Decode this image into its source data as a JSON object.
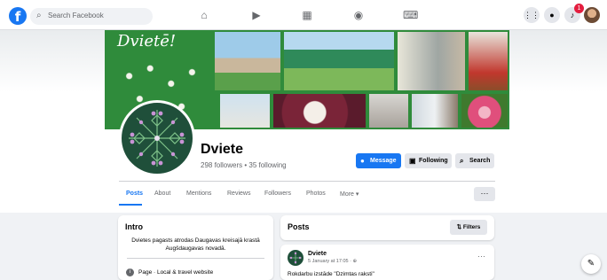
{
  "topbar": {
    "search_placeholder": "Search Facebook",
    "nav_icons": [
      "home-icon",
      "video-icon",
      "marketplace-icon",
      "groups-icon",
      "gaming-icon"
    ],
    "notification_count": "1"
  },
  "cover": {
    "title": "Dvietē!"
  },
  "page": {
    "name": "Dviete",
    "stats": "298 followers • 35 following"
  },
  "actions": {
    "message": "Message",
    "following": "Following",
    "search": "Search"
  },
  "tabs": [
    {
      "label": "Posts",
      "active": true
    },
    {
      "label": "About"
    },
    {
      "label": "Mentions"
    },
    {
      "label": "Reviews"
    },
    {
      "label": "Followers"
    },
    {
      "label": "Photos"
    },
    {
      "label": "More ▾"
    }
  ],
  "intro": {
    "title": "Intro",
    "bio": "Dvietes pagasts atrodas Daugavas kreisajā krastā Augšdaugavas novadā.",
    "info": "Page · Local & travel website"
  },
  "posts": {
    "title": "Posts",
    "filters": "Filters"
  },
  "post": {
    "author": "Dviete",
    "meta": "5 January at 17:05 · ⊕",
    "text": "Rokdarbu izstāde \"Dzimtas raksti\""
  },
  "colors": {
    "brand": "#1877f2",
    "cover_green": "#2f8b3b"
  }
}
